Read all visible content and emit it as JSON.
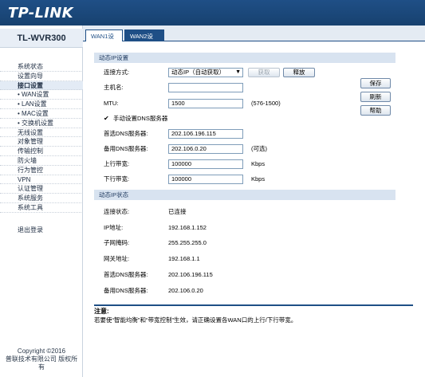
{
  "brand": {
    "logo_text": "TP-LINK"
  },
  "sidebar": {
    "model": "TL-WVR300",
    "items": [
      {
        "label": "系统状态"
      },
      {
        "label": "设置向导"
      },
      {
        "label": "接口设置"
      },
      {
        "label": "• WAN设置"
      },
      {
        "label": "• LAN设置"
      },
      {
        "label": "• MAC设置"
      },
      {
        "label": "• 交换机设置"
      },
      {
        "label": "无线设置"
      },
      {
        "label": "对象管理"
      },
      {
        "label": "传输控制"
      },
      {
        "label": "防火墙"
      },
      {
        "label": "行为管控"
      },
      {
        "label": "VPN"
      },
      {
        "label": "认证管理"
      },
      {
        "label": "系统服务"
      },
      {
        "label": "系统工具"
      }
    ],
    "logout": "退出登录",
    "copyright_line1": "Copyright ©2016",
    "copyright_line2": "普联技术有限公司 版权所",
    "copyright_line3": "有"
  },
  "tabs": [
    {
      "label": "WAN1设置"
    },
    {
      "label": "WAN2设置"
    }
  ],
  "dynamic_ip_settings": {
    "section_title": "动态IP设置",
    "connection_mode_label": "连接方式:",
    "connection_mode_value": "动态IP（自动获取）",
    "get_button": "获取",
    "release_button": "释放",
    "hostname_label": "主机名:",
    "hostname_value": "",
    "mtu_label": "MTU:",
    "mtu_value": "1500",
    "mtu_range": "(576-1500)",
    "manual_dns_checkbox": "✔",
    "manual_dns_label": "手动设置DNS服务器",
    "primary_dns_label": "首选DNS服务器:",
    "primary_dns_value": "202.106.196.115",
    "secondary_dns_label": "备用DNS服务器:",
    "secondary_dns_value": "202.106.0.20",
    "secondary_dns_note": "(可选)",
    "upload_label": "上行带宽:",
    "upload_value": "100000",
    "upload_unit": "Kbps",
    "download_label": "下行带宽:",
    "download_value": "100000",
    "download_unit": "Kbps"
  },
  "actions": {
    "save": "保存",
    "refresh": "刷新",
    "help": "帮助"
  },
  "dynamic_ip_status": {
    "section_title": "动态IP状态",
    "status_label": "连接状态:",
    "status_value": "已连接",
    "ip_label": "IP地址:",
    "ip_value": "192.168.1.152",
    "mask_label": "子网掩码:",
    "mask_value": "255.255.255.0",
    "gateway_label": "网关地址:",
    "gateway_value": "192.168.1.1",
    "primary_dns_label": "首选DNS服务器:",
    "primary_dns_value": "202.106.196.115",
    "secondary_dns_label": "备用DNS服务器:",
    "secondary_dns_value": "202.106.0.20"
  },
  "note": {
    "title": "注意:",
    "text": "若要使“智能均衡”和“带宽控制”生效，请正确设置各WAN口的上行/下行带宽。"
  },
  "colors": {
    "header": "#1f4f86",
    "section_bar": "#d8e3f0"
  }
}
